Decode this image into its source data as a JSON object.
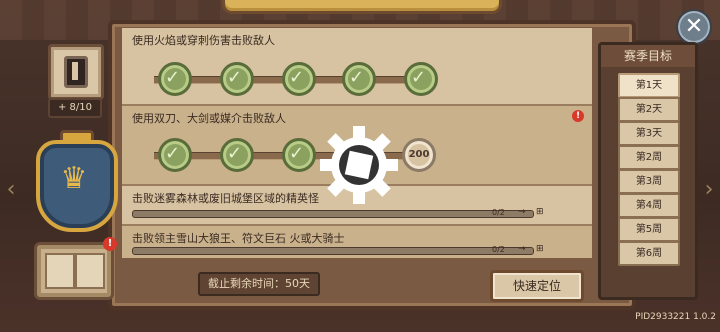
{
  "level": {
    "count": "8/10",
    "count_prefix": "+"
  },
  "badge_alert": "!",
  "quests": [
    {
      "title": "使用火焰或穿刺伤害击败敌人",
      "type": "milestone",
      "nodes": [
        "done",
        "done",
        "done",
        "done",
        "done"
      ]
    },
    {
      "title": "使用双刀、大剑或媒介击败敌人",
      "type": "milestone",
      "alert": "!",
      "nodes": [
        "done",
        "done",
        "done",
        "done"
      ],
      "reward": "200"
    },
    {
      "title": "击败迷雾森林或废旧城堡区域的精英怪",
      "type": "progress",
      "progress_text": "0/2",
      "progress": 0
    },
    {
      "title": "击败领主雪山大狼王、符文巨石 火或大骑士",
      "type": "progress",
      "progress_text": "0/2",
      "progress": 0
    }
  ],
  "season": {
    "title": "赛季目标",
    "days": [
      "第1天",
      "第2天",
      "第3天",
      "第2周",
      "第3周",
      "第4周",
      "第5周",
      "第6周"
    ],
    "active_index": 0
  },
  "footer": {
    "deadline": "截止剩余时间：50天",
    "locate_button": "快速定位",
    "version": "PID2933221 1.0.2"
  },
  "close_glyph": "✕",
  "colors": {
    "accent_gold": "#d8a63f",
    "node_green": "#8aa160",
    "alert_red": "#d8392b"
  }
}
